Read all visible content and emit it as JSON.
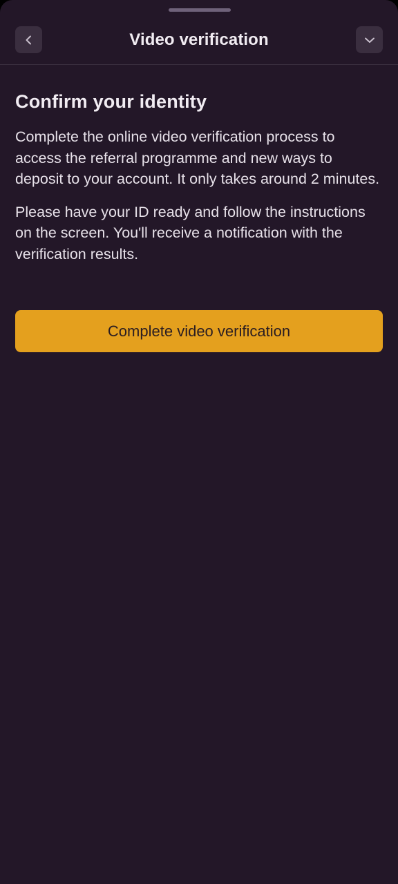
{
  "header": {
    "title": "Video verification",
    "back_icon": "chevron-left-icon",
    "collapse_icon": "chevron-down-icon"
  },
  "main": {
    "heading": "Confirm your identity",
    "paragraphs": [
      "Complete the online video verification process to access the referral programme and new ways to deposit to your account. It only takes around 2 minutes.",
      "Please have your ID ready and follow the instructions on the screen. You'll receive a notification with the verification results."
    ],
    "cta_label": "Complete video verification"
  },
  "colors": {
    "background": "#231728",
    "accent": "#e4a01e",
    "icon_button": "#3a2e3f",
    "text": "#f1ecf2"
  }
}
